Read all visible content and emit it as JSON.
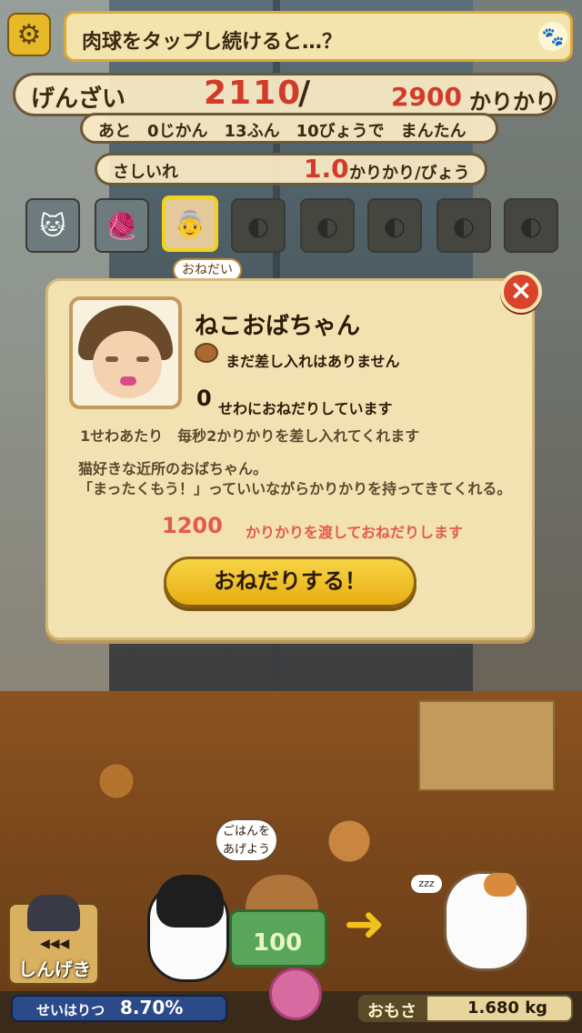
{
  "top": {
    "hint": "肉球をタップし続けると…？",
    "icons": {
      "settings": "gear-icon",
      "paw": "paw-icon"
    }
  },
  "status": {
    "current_label": "げんざい",
    "current_value": "2110",
    "slash": "/",
    "max_value": "2900",
    "max_unit": "かりかり",
    "remaining": "あと　0じかん　13ふん　10びょうで　まんたん",
    "rate_label": "さしいれ",
    "rate_value": "1.0",
    "rate_unit": "かりかり/びょう"
  },
  "slots": {
    "selected_bubble": "おねだい"
  },
  "modal": {
    "name": "ねこおばちゃん",
    "no_gift": "まだ差し入れはありません",
    "care_count": "0",
    "care_text": "せわにおねだりしています",
    "rate_desc": "1せわあたり　毎秒2かりかりを差し入れてくれます",
    "desc_line1": "猫好きな近所のおばちゃん。",
    "desc_line2": "「まったくもう！」っていいながらかりかりを持ってきてくれる。",
    "cost_value": "1200",
    "cost_text": "かりかりを渡しておねだりします",
    "button": "おねだりする！",
    "close": "×"
  },
  "bottom": {
    "feed_bubble": "ごはんを あげよう",
    "bowl_value": "100",
    "zzz": "zzz",
    "attack_label": "しんげき",
    "attack_arrows": "◀◀◀",
    "success_label": "せいはりつ",
    "success_value": "8.70%",
    "weight_label": "おもさ",
    "weight_value": "1.680 kg"
  },
  "colors": {
    "accent_red": "#d23a2a",
    "panel": "#f3e2b1",
    "button_yellow": "#f7d545"
  }
}
